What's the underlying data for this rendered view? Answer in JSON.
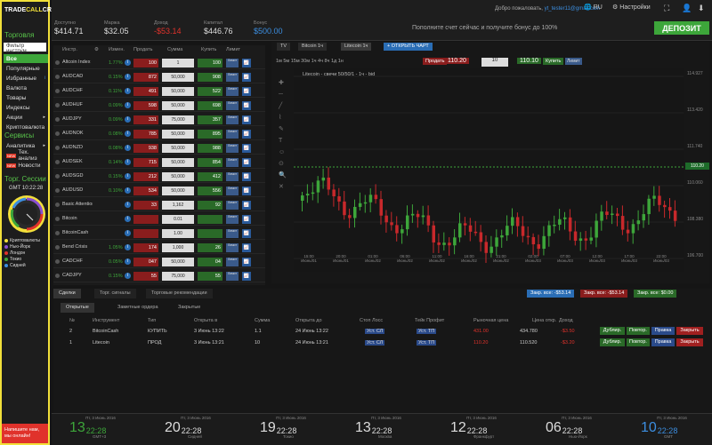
{
  "brand": {
    "left": "TRADE",
    "mid": "CALL",
    "right": "CRYPTO"
  },
  "sidebar": {
    "trading": "Торговля",
    "filter_placeholder": "Фильтр инструм",
    "items": [
      "Все",
      "Популярные",
      "Избранные",
      "Валюта",
      "Товары",
      "Индексы",
      "Акции",
      "Криптовалюта"
    ],
    "services": "Сервисы",
    "service_items": [
      "Аналитика",
      "Тех. анализ",
      "Новости"
    ],
    "new_badge": "NEW",
    "sessions": "Торг. Сессии",
    "gmt": "GMT 10:22:28",
    "legend": [
      {
        "label": "Криптовалюты",
        "color": "#f2e03a"
      },
      {
        "label": "Нью-Йорк",
        "color": "#8a4fd0"
      },
      {
        "label": "Лондон",
        "color": "#e0322b"
      },
      {
        "label": "Токио",
        "color": "#3da63a"
      },
      {
        "label": "Сидней",
        "color": "#3c8ee0"
      }
    ],
    "help": "Напишите нам, мы онлайн!"
  },
  "topbar": {
    "stats": [
      {
        "label": "Доступно",
        "value": "$414.71",
        "cls": ""
      },
      {
        "label": "Маржа",
        "value": "$32.05",
        "cls": ""
      },
      {
        "label": "Доход",
        "value": "-$53.14",
        "cls": "r"
      },
      {
        "label": "Капитал",
        "value": "$446.76",
        "cls": ""
      },
      {
        "label": "Бонус",
        "value": "$500.00",
        "cls": "b"
      }
    ],
    "welcome": "Добро пожаловать, ",
    "email": "yt_tester11@gmail.com",
    "lang": "RU",
    "settings": "Настройки",
    "bonus": "Пополните счет сейчас и получите бонус до 100%",
    "deposit": "ДЕПОЗИТ"
  },
  "instruments": {
    "headers": {
      "instr": "Инстр.",
      "change": "Измен.",
      "sell": "Продать",
      "sum": "Сумма",
      "buy": "Купить",
      "limit": "Лимит"
    },
    "rows": [
      {
        "name": "Altcoin Index",
        "sub": "",
        "change": "1.77%",
        "cls": "g",
        "sell": "100",
        "amt": "1",
        "buy": "100"
      },
      {
        "name": "AUDCAD",
        "sub": "",
        "change": "0.15%",
        "cls": "g",
        "sell": "872",
        "amt": "50,000",
        "buy": "908"
      },
      {
        "name": "AUDCHF",
        "sub": "",
        "change": "0.11%",
        "cls": "g",
        "sell": "491",
        "amt": "50,000",
        "buy": "522"
      },
      {
        "name": "AUDHUF",
        "sub": "",
        "change": "0.09%",
        "cls": "g",
        "sell": "598",
        "amt": "50,000",
        "buy": "698"
      },
      {
        "name": "AUDJPY",
        "sub": "",
        "change": "0.09%",
        "cls": "g",
        "sell": "331",
        "amt": "75,000",
        "buy": "357"
      },
      {
        "name": "AUDNOK",
        "sub": "",
        "change": "0.08%",
        "cls": "g",
        "sell": "785",
        "amt": "50,000",
        "buy": "895"
      },
      {
        "name": "AUDNZD",
        "sub": "",
        "change": "0.08%",
        "cls": "g",
        "sell": "938",
        "amt": "50,000",
        "buy": "988"
      },
      {
        "name": "AUDSEK",
        "sub": "",
        "change": "0.14%",
        "cls": "g",
        "sell": "715",
        "amt": "50,000",
        "buy": "854"
      },
      {
        "name": "AUDSGD",
        "sub": "",
        "change": "0.15%",
        "cls": "g",
        "sell": "212",
        "amt": "50,000",
        "buy": "412"
      },
      {
        "name": "AUDUSD",
        "sub": "",
        "change": "0.10%",
        "cls": "g",
        "sell": "534",
        "amt": "50,000",
        "buy": "556"
      },
      {
        "name": "Basic Attention",
        "sub": "",
        "change": "",
        "cls": "g",
        "sell": "33",
        "amt": "1,162",
        "buy": "92"
      },
      {
        "name": "Bitcoin",
        "sub": "",
        "change": "",
        "cls": "g",
        "sell": "",
        "amt": "0.01",
        "buy": ""
      },
      {
        "name": "BitcoinCash",
        "sub": "",
        "change": "",
        "cls": "g",
        "sell": "",
        "amt": "1.00",
        "buy": ""
      },
      {
        "name": "Bend Crisis",
        "sub": "",
        "change": "1.05%",
        "cls": "g",
        "sell": "174",
        "amt": "1,000",
        "buy": "26"
      },
      {
        "name": "CADCHF",
        "sub": "",
        "change": "0.05%",
        "cls": "g",
        "sell": "047",
        "amt": "50,000",
        "buy": "04"
      },
      {
        "name": "CADJPY",
        "sub": "",
        "change": "0.15%",
        "cls": "g",
        "sell": "55",
        "amt": "75,000",
        "buy": "55"
      }
    ]
  },
  "chart": {
    "tabs": [
      "TV",
      "Bitcoin 1ч",
      "Litecoin 1ч",
      "+ ОТКРЫТЬ ЧАРТ"
    ],
    "timeframes": "1м  5м  15м  30м  1ч  4ч  8ч  1д  1н",
    "sell_label": "Продать",
    "buy_label": "Купить",
    "sell_price": "110.20",
    "buy_price": "110.10",
    "amount": "10",
    "limit_label": "Лимит",
    "title": "Litecoin - свечи 50/50/1 - 1ч - bid",
    "price_tag": "110.20",
    "y_ticks": [
      "114.927",
      "113.420",
      "111.740",
      "110.060",
      "108.380",
      "106.700"
    ],
    "x_ticks": [
      [
        "15:00",
        "Июнь/01"
      ],
      [
        "20:00",
        "Июнь/01"
      ],
      [
        "01:00",
        "Июнь/02"
      ],
      [
        "06:00",
        "Июнь/02"
      ],
      [
        "11:00",
        "Июнь/02"
      ],
      [
        "16:00",
        "Июнь/02"
      ],
      [
        "21:00",
        "Июнь/02"
      ],
      [
        "02:00",
        "Июнь/03"
      ],
      [
        "07:00",
        "Июнь/03"
      ],
      [
        "12:00",
        "Июнь/03"
      ],
      [
        "17:00",
        "Июнь/03"
      ],
      [
        "22:00",
        "Июнь/03"
      ]
    ]
  },
  "bottom": {
    "tabs": [
      "Сделки",
      "Торг. сигналы",
      "Торговые рекомендации"
    ],
    "subtabs": [
      "Открытые",
      "Заметные ордера",
      "Закрытые"
    ],
    "close_all": "Закр. все: -$53.14",
    "close_loss": "Закр. все: -$53.14",
    "close_profit": "Закр. все: $0.00",
    "headers": [
      "№",
      "Инструмент",
      "Тип",
      "Открыта в",
      "Сумма",
      "Открыта до",
      "Стоп Лосс",
      "Тейк Профит",
      "Рыночная цена",
      "Цена откр.",
      "Доход"
    ],
    "rows": [
      {
        "n": "2",
        "instr": "BitcoinCash",
        "type": "КУПИТЬ",
        "opened": "3 Июнь 13:22",
        "sum": "1.1",
        "until": "24 Июнь 13:22",
        "sl": "Уст. СЛ",
        "tp": "Уст. ТП",
        "mkt": "431.00",
        "open": "434.780",
        "profit": "-$3.50"
      },
      {
        "n": "1",
        "instr": "Litecoin",
        "type": "ПРОД",
        "opened": "3 Июнь 13:21",
        "sum": "10",
        "until": "24 Июнь 13:21",
        "sl": "Уст. СЛ",
        "tp": "Уст. ТП",
        "mkt": "110.20",
        "open": "110.520",
        "profit": "-$3.20"
      }
    ],
    "actions": [
      "Дублир.",
      "Повтор.",
      "Правка",
      "Закрыть"
    ]
  },
  "footer": {
    "clocks": [
      {
        "date": "Пт, 3 Июнь 2016",
        "hour": "13",
        "min": "22:28",
        "city": "GMT+3",
        "color": "#3da63a"
      },
      {
        "date": "Пт, 3 Июнь 2016",
        "hour": "20",
        "min": "22:28",
        "city": "Сидней",
        "color": "#ddd"
      },
      {
        "date": "Пт, 3 Июнь 2016",
        "hour": "19",
        "min": "22:28",
        "city": "Токио",
        "color": "#ddd"
      },
      {
        "date": "Пт, 3 Июнь 2016",
        "hour": "13",
        "min": "22:28",
        "city": "Москва",
        "color": "#ddd"
      },
      {
        "date": "Пт, 3 Июнь 2016",
        "hour": "12",
        "min": "22:28",
        "city": "Франкфурт",
        "color": "#ddd"
      },
      {
        "date": "Пт, 3 Июнь 2016",
        "hour": "06",
        "min": "22:28",
        "city": "Нью-Йорк",
        "color": "#ddd"
      },
      {
        "date": "Пт, 3 Июнь 2016",
        "hour": "10",
        "min": "22:28",
        "city": "GMT",
        "color": "#3c8ee0"
      }
    ]
  }
}
